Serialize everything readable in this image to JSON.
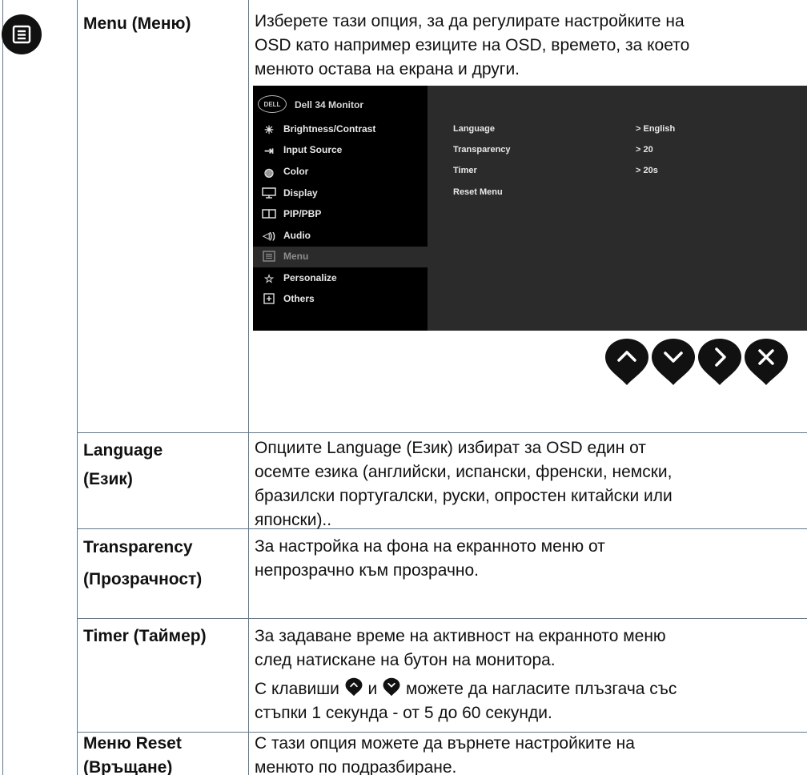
{
  "rows": [
    {
      "term": "Menu (Меню)",
      "desc": [
        "Изберете тази опция, за да регулирате настройките на",
        "OSD като например езиците на OSD, времето, за което",
        "менюто остава на екрана и други."
      ]
    },
    {
      "term_lines": [
        "Language",
        "(Език)"
      ],
      "desc": [
        "Опциите Language (Език) избират за OSD един от",
        "осемте езика (английски, испански, френски, немски,",
        "бразилски португалски, руски, опростен китайски или",
        "японски).."
      ]
    },
    {
      "term_lines": [
        "Transparency",
        "(Прозрачност)"
      ],
      "desc": [
        "За настройка на фона на екранното меню от",
        "непрозрачно към прозрачно."
      ]
    },
    {
      "term": "Timer (Таймер)",
      "desc": [
        "За задаване време на активност на екранното меню",
        "след натискане на бутон на монитора."
      ],
      "desc2_a": "С клавиши",
      "desc2_b": "и",
      "desc2_c": "можете да нагласите плъзгача със",
      "desc3": "стъпки 1 секунда - от 5 до 60 секунди."
    },
    {
      "term_lines": [
        "Меню Reset",
        "(Връщане)"
      ],
      "desc": [
        "С тази опция можете да върнете настройките на",
        "менюто по подразбиране."
      ]
    }
  ],
  "osd": {
    "logo": "DELL",
    "title": "Dell 34 Monitor",
    "menu": [
      {
        "label": "Brightness/Contrast",
        "icon": "brightness-icon"
      },
      {
        "label": "Input Source",
        "icon": "input-source-icon"
      },
      {
        "label": "Color",
        "icon": "color-icon"
      },
      {
        "label": "Display",
        "icon": "display-icon"
      },
      {
        "label": "PIP/PBP",
        "icon": "pip-pbp-icon"
      },
      {
        "label": "Audio",
        "icon": "audio-icon"
      },
      {
        "label": "Menu",
        "icon": "menu-icon",
        "selected": true
      },
      {
        "label": "Personalize",
        "icon": "star-icon"
      },
      {
        "label": "Others",
        "icon": "others-icon"
      }
    ],
    "settings": [
      {
        "label": "Language",
        "value": "> English"
      },
      {
        "label": "Transparency",
        "value": "> 20"
      },
      {
        "label": "Timer",
        "value": "> 20s"
      },
      {
        "label": "Reset Menu",
        "value": ""
      }
    ]
  },
  "nav_buttons": [
    "up-icon",
    "down-icon",
    "right-icon",
    "close-icon"
  ],
  "colors": {
    "grid": "#5a7a96",
    "osd_left": "#000000",
    "osd_right": "#2b2b2b"
  }
}
